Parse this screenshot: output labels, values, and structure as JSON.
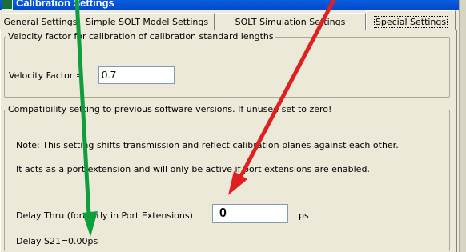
{
  "window": {
    "title": "Calibration Settings"
  },
  "tabs": [
    {
      "label": "General Settings",
      "active": false
    },
    {
      "label": "Simple SOLT Model Settings",
      "active": false
    },
    {
      "label": "SOLT Simulation Settings",
      "active": false
    },
    {
      "label": "Special Settings",
      "active": true
    }
  ],
  "velocity_group": {
    "legend": "Velocity factor for calibration of calibration standard lengths",
    "label": "Velocity Factor =",
    "value": "0.7"
  },
  "compat_group": {
    "legend": "Compatibility setting to previous software versions. If unused set to zero!",
    "note_line1": "Note: This setting shifts transmission and reflect calibration planes against each other.",
    "note_line2": "It acts as a port extension and will only be active if port extensions are enabled.",
    "delay_label": "Delay Thru (formerly in Port Extensions)",
    "delay_value": "0",
    "delay_unit": "ps",
    "s21_label": "Delay S21=",
    "s21_value": "0.00ps"
  },
  "colors": {
    "window_bg": "#ece9d8",
    "title_bar": "#0054e3",
    "arrow_green": "#0f9e3c",
    "arrow_red": "#e02020"
  }
}
